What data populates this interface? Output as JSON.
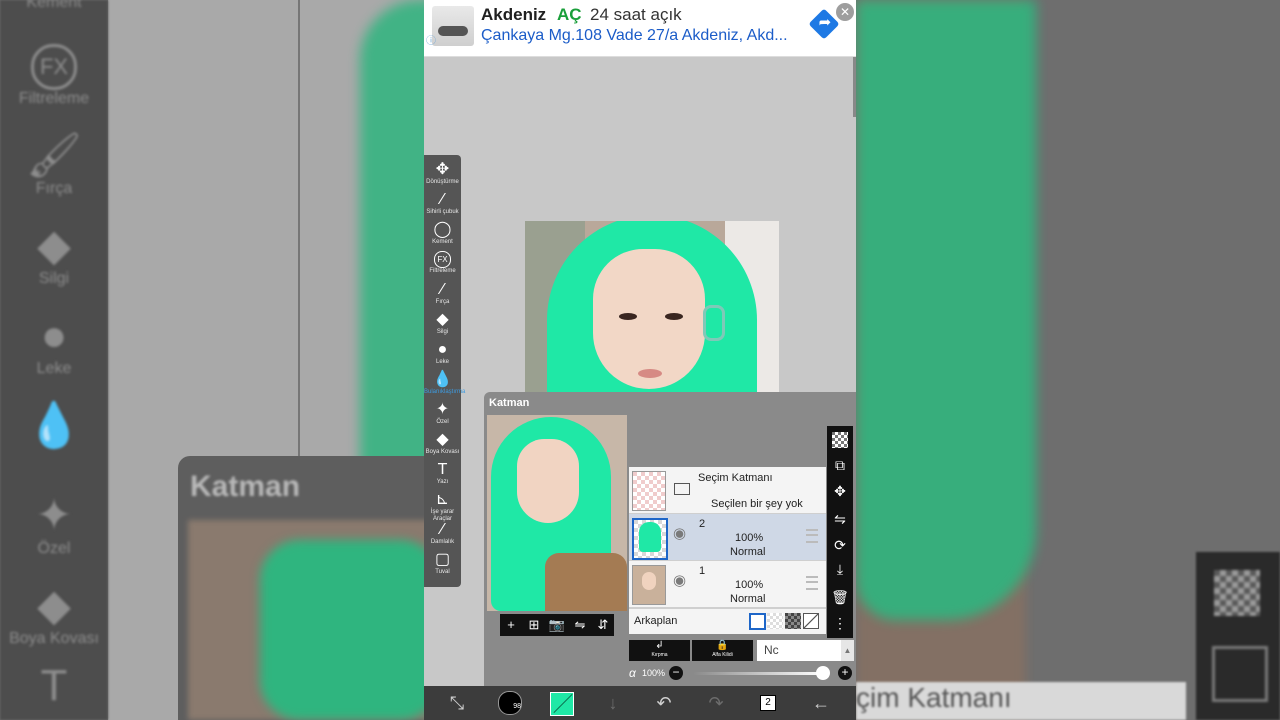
{
  "ad": {
    "title": "Akdeniz",
    "open": "AÇ",
    "hours": "24 saat açık",
    "address": "Çankaya Mg.108 Vade 27/a Akdeniz, Akd...",
    "close_glyph": "✕",
    "dir_glyph": "➦"
  },
  "background_left": {
    "tools": [
      {
        "label": "Kement",
        "icon": "lasso-icon",
        "glyph": ""
      },
      {
        "label": "Filtreleme",
        "icon": "fx-icon",
        "glyph": "FX"
      },
      {
        "label": "Fırça",
        "icon": "brush-icon",
        "glyph": "🖌"
      },
      {
        "label": "Silgi",
        "icon": "eraser-icon",
        "glyph": "◆"
      },
      {
        "label": "Leke",
        "icon": "smudge-icon",
        "glyph": "●"
      },
      {
        "label": "",
        "icon": "blur-icon",
        "glyph": "💧"
      },
      {
        "label": "Özel",
        "icon": "magic-wand-icon",
        "glyph": "✦"
      },
      {
        "label": "Boya Kovası",
        "icon": "bucket-icon",
        "glyph": "◆"
      },
      {
        "label": "",
        "icon": "text-icon",
        "glyph": "T"
      }
    ],
    "panel_title": "Katman"
  },
  "background_right": {
    "strip_text": "çim Katmanı"
  },
  "toolbar": {
    "tools": [
      {
        "label": "Dönüştürme",
        "icon": "move-icon",
        "glyph": "✥"
      },
      {
        "label": "Sihirli çubuk",
        "icon": "magic-wand-icon",
        "glyph": "⁄"
      },
      {
        "label": "Kement",
        "icon": "lasso-icon",
        "glyph": "◯"
      },
      {
        "label": "Filtreleme",
        "icon": "fx-icon",
        "glyph": "FX"
      },
      {
        "label": "Fırça",
        "icon": "brush-icon",
        "glyph": "⁄"
      },
      {
        "label": "Silgi",
        "icon": "eraser-icon",
        "glyph": "◆"
      },
      {
        "label": "Leke",
        "icon": "smudge-icon",
        "glyph": "●"
      },
      {
        "label": "Bulanıklaştırma",
        "icon": "blur-icon",
        "glyph": "💧"
      },
      {
        "label": "Özel",
        "icon": "special-icon",
        "glyph": "✦"
      },
      {
        "label": "Boya Kovası",
        "icon": "bucket-icon",
        "glyph": "◆"
      },
      {
        "label": "Yazı",
        "icon": "text-icon",
        "glyph": "T"
      },
      {
        "label": "İşe yarar Araçlar",
        "icon": "ruler-icon",
        "glyph": "⊾"
      },
      {
        "label": "Damlalık",
        "icon": "eyedropper-icon",
        "glyph": "⁄"
      },
      {
        "label": "Tuval",
        "icon": "canvas-icon",
        "glyph": "▢"
      }
    ],
    "active_index": 7,
    "active_color": "#3d9be0"
  },
  "layer_panel": {
    "title": "Katman",
    "preview_tools": [
      {
        "icon": "add-layer-icon",
        "glyph": "+"
      },
      {
        "icon": "add-layer-box-icon",
        "glyph": "⊞"
      },
      {
        "icon": "camera-icon",
        "glyph": "📷"
      },
      {
        "icon": "flip-horizontal-icon",
        "glyph": "⇋"
      },
      {
        "icon": "flip-vertical-icon",
        "glyph": "⇵"
      }
    ],
    "selection_layer": {
      "name": "Seçim Katmanı",
      "status": "Seçilen bir şey yok"
    },
    "layers": [
      {
        "number": "2",
        "opacity": "100%",
        "blend": "Normal",
        "selected": true
      },
      {
        "number": "1",
        "opacity": "100%",
        "blend": "Normal",
        "selected": false
      }
    ],
    "background_label": "Arkaplan",
    "clip_label": "Kırpma",
    "clip_glyph": "↲",
    "lock_label": "Alfa Kilidi",
    "lock_glyph": "🔒",
    "blend_value": "Nc",
    "alpha_symbol": "α",
    "alpha_value": "100%",
    "minus": "−",
    "plus": "+"
  },
  "right_tools": [
    {
      "icon": "checkerboard-icon",
      "glyph": ""
    },
    {
      "icon": "transfer-layer-icon",
      "glyph": "⧉"
    },
    {
      "icon": "move-layer-icon",
      "glyph": "✥"
    },
    {
      "icon": "flip-icon",
      "glyph": "⇋"
    },
    {
      "icon": "rotate-icon",
      "glyph": "⟳"
    },
    {
      "icon": "merge-down-icon",
      "glyph": "⤓"
    },
    {
      "icon": "delete-icon",
      "glyph": "🗑"
    },
    {
      "icon": "more-icon",
      "glyph": "⋮"
    }
  ],
  "bottom_bar": {
    "brush_size": "98",
    "transform_glyph": "⤡",
    "down_glyph": "↓",
    "undo_glyph": "↶",
    "redo_glyph": "↷",
    "layers_glyph": "2",
    "back_glyph": "←",
    "color": "#1fe8a6"
  }
}
